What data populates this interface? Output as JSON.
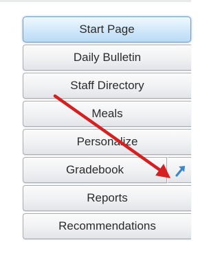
{
  "nav": {
    "items": [
      {
        "label": "Start Page",
        "active": true
      },
      {
        "label": "Daily Bulletin"
      },
      {
        "label": "Staff Directory"
      },
      {
        "label": "Meals"
      },
      {
        "label": "Personalize"
      },
      {
        "label": "Gradebook",
        "has_launch_icon": true
      },
      {
        "label": "Reports"
      },
      {
        "label": "Recommendations"
      }
    ]
  },
  "icons": {
    "launch": "external-link-arrow-icon",
    "annotation": "red-pointer-arrow"
  },
  "colors": {
    "active_fill": "#c9e4f8",
    "active_border": "#6e9fc7",
    "button_fill": "#f0f1f3",
    "button_border": "#a8acb2",
    "text": "#2b2b2b",
    "annotation_arrow": "#d42020",
    "launch_icon": "#3a86c8"
  }
}
